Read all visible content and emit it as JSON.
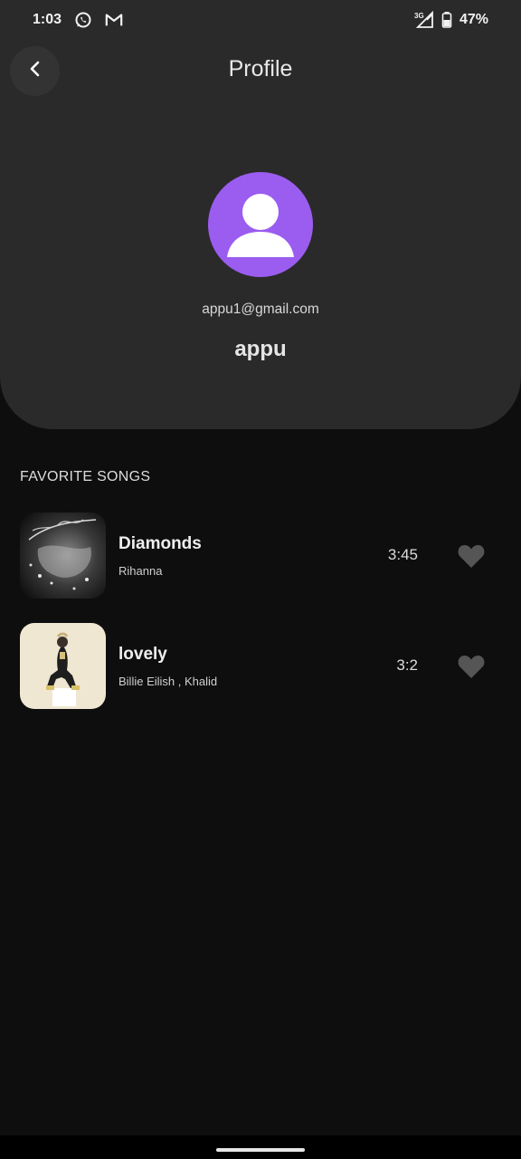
{
  "status_bar": {
    "time": "1:03",
    "icons_left": [
      "whatsapp-icon",
      "gmail-icon"
    ],
    "network": "3G",
    "battery": "47%"
  },
  "header": {
    "back_icon": "chevron-left-icon",
    "title": "Profile"
  },
  "profile": {
    "avatar_icon": "person-icon",
    "avatar_color": "#9b5cf0",
    "email": "appu1@gmail.com",
    "name": "appu"
  },
  "favorites": {
    "section_title": "FAVORITE SONGS",
    "songs": [
      {
        "title": "Diamonds",
        "artist": "Rihanna",
        "duration": "3:45",
        "favorited": true
      },
      {
        "title": "lovely",
        "artist": "Billie Eilish , Khalid",
        "duration": "3:2",
        "favorited": true
      }
    ]
  },
  "colors": {
    "background": "#0e0e0e",
    "card": "#2a2a2a",
    "heart": "#555555"
  }
}
